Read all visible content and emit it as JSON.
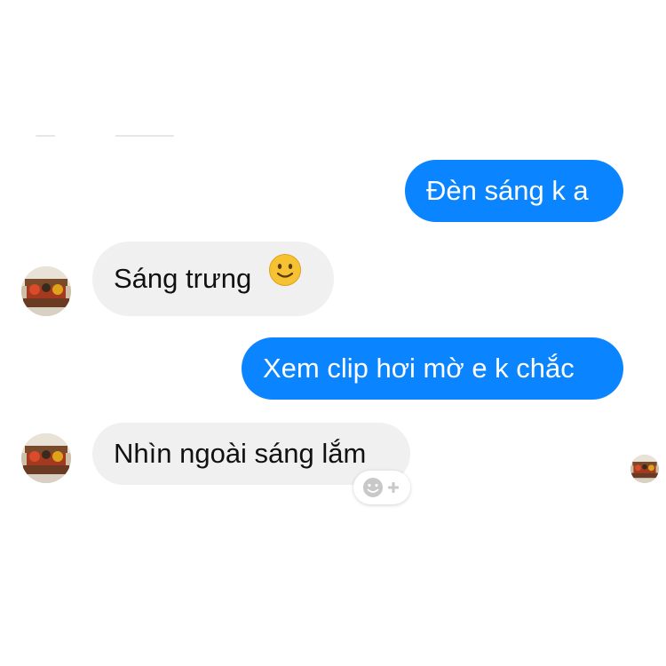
{
  "conversation": {
    "messages": [
      {
        "direction": "outgoing",
        "text": "Đèn sáng k a"
      },
      {
        "direction": "incoming",
        "text": "Sáng trưng",
        "emoji": "slightly-smiling-face-icon"
      },
      {
        "direction": "outgoing",
        "text": "Xem clip hơi mờ e k chắc"
      },
      {
        "direction": "incoming",
        "text": "Nhìn ngoài sáng lắm"
      }
    ]
  },
  "colors": {
    "outgoing_bubble": "#0a84ff",
    "incoming_bubble": "#f0f0f0",
    "outgoing_text": "#ffffff",
    "incoming_text": "#111111",
    "emoji_face": "#f7c232"
  },
  "icons": {
    "reaction_button": "add-reaction-icon",
    "contact_avatar": "contact-avatar",
    "seen_indicator": "seen-avatar"
  }
}
